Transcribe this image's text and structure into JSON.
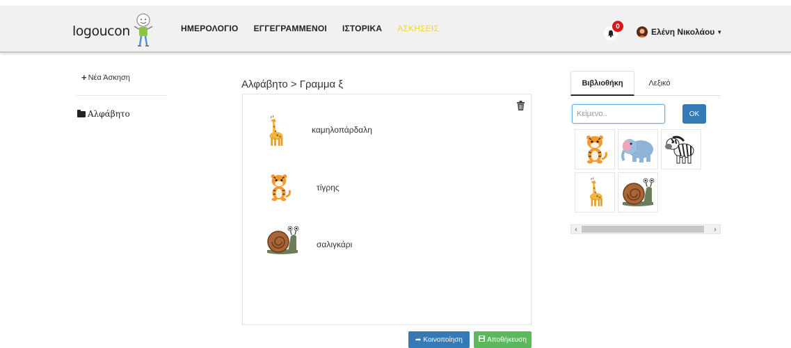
{
  "brand": {
    "name": "logoucon"
  },
  "nav": {
    "links": [
      {
        "label": "ΗΜΕΡΟΛΟΓΙΟ",
        "active": false
      },
      {
        "label": "ΕΓΓΕΓΡΑΜΜΕΝΟΙ",
        "active": false
      },
      {
        "label": "ΙΣΤΟΡΙΚΑ",
        "active": false
      },
      {
        "label": "ΑΣΚΗΣΕΙΣ",
        "active": true
      }
    ],
    "notifications": {
      "count": "0",
      "icon": "bell-icon"
    },
    "user": {
      "name": "Ελένη Νικολάου",
      "icon": "caret-down-icon"
    }
  },
  "sidebar": {
    "new_exercise_label": "Νέα Άσκηση",
    "folders": [
      {
        "label": "Αλφάβητο",
        "icon": "folder-icon"
      }
    ]
  },
  "main": {
    "breadcrumb": "Αλφάβητο > Γραμμα ξ",
    "items": [
      {
        "label": "καμηλοπάρδαλη",
        "image": "giraffe"
      },
      {
        "label": "τίγρης",
        "image": "tiger"
      },
      {
        "label": "σαλιγκάρι",
        "image": "snail"
      }
    ],
    "share_label": "Κοινοποίηση",
    "save_label": "Αποθήκευση"
  },
  "library": {
    "tabs": [
      {
        "label": "Βιβλιοθήκη",
        "active": true
      },
      {
        "label": "Λεξικό",
        "active": false
      }
    ],
    "search": {
      "placeholder": "Κείμενο..",
      "value": ""
    },
    "ok_label": "OK",
    "images": [
      "tiger",
      "elephant",
      "zebra",
      "giraffe",
      "snail"
    ]
  },
  "colors": {
    "primary": "#337ab7",
    "success": "#5cb85c",
    "active_nav": "#f2d23b",
    "badge": "#d9161c"
  }
}
